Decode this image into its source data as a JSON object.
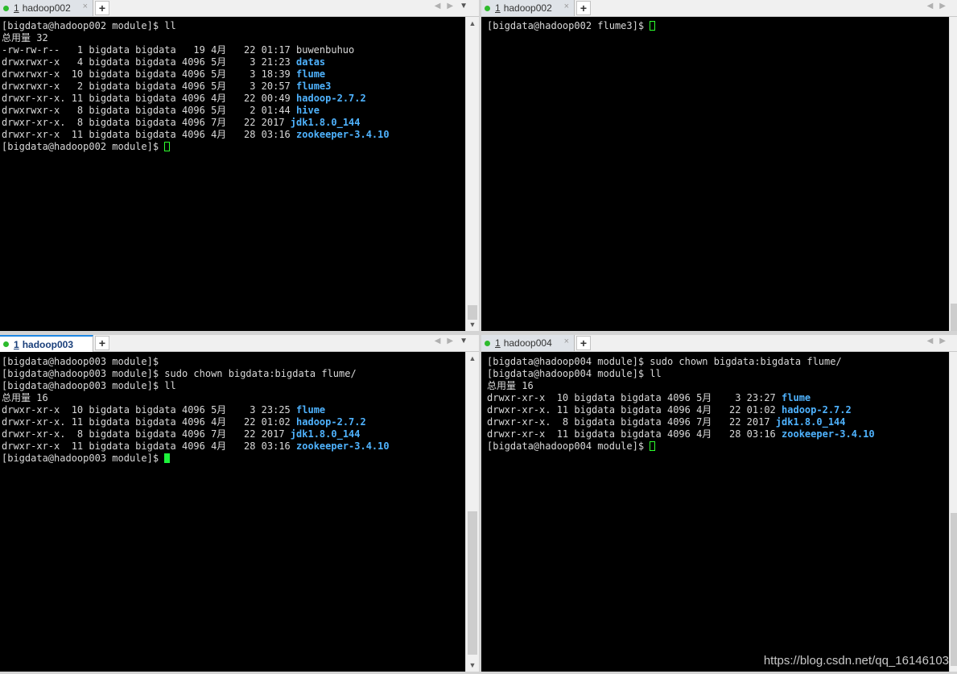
{
  "icons": {
    "close": "×",
    "plus": "+",
    "nav_left": "◀",
    "nav_right": "▶",
    "menu": "▼",
    "scroll_up": "▲",
    "scroll_down": "▼"
  },
  "panes": {
    "p1": {
      "tab": {
        "num": "1",
        "name": "hadoop002"
      },
      "lines": [
        [
          {
            "t": "[bigdata@hadoop002 module]$ ll"
          }
        ],
        [
          {
            "t": "总用量 32"
          }
        ],
        [
          {
            "t": "-rw-rw-r--   1 bigdata bigdata   19 4月   22 01:17 buwenbuhuo"
          }
        ],
        [
          {
            "t": "drwxrwxr-x   4 bigdata bigdata 4096 5月    3 21:23 "
          },
          {
            "t": "datas",
            "c": "dir"
          }
        ],
        [
          {
            "t": "drwxrwxr-x  10 bigdata bigdata 4096 5月    3 18:39 "
          },
          {
            "t": "flume",
            "c": "dir"
          }
        ],
        [
          {
            "t": "drwxrwxr-x   2 bigdata bigdata 4096 5月    3 20:57 "
          },
          {
            "t": "flume3",
            "c": "dir"
          }
        ],
        [
          {
            "t": "drwxr-xr-x. 11 bigdata bigdata 4096 4月   22 00:49 "
          },
          {
            "t": "hadoop-2.7.2",
            "c": "dir"
          }
        ],
        [
          {
            "t": "drwxrwxr-x   8 bigdata bigdata 4096 5月    2 01:44 "
          },
          {
            "t": "hive",
            "c": "dir"
          }
        ],
        [
          {
            "t": "drwxr-xr-x.  8 bigdata bigdata 4096 7月   22 2017 "
          },
          {
            "t": "jdk1.8.0_144",
            "c": "dir"
          }
        ],
        [
          {
            "t": "drwxr-xr-x  11 bigdata bigdata 4096 4月   28 03:16 "
          },
          {
            "t": "zookeeper-3.4.10",
            "c": "dir"
          }
        ],
        [
          {
            "t": "[bigdata@hadoop002 module]$ "
          },
          {
            "c": "cur"
          }
        ]
      ]
    },
    "p2": {
      "tab": {
        "num": "1",
        "name": "hadoop002"
      },
      "lines": [
        [
          {
            "t": "[bigdata@hadoop002 flume3]$ "
          },
          {
            "c": "cur"
          }
        ]
      ]
    },
    "p3": {
      "tab": {
        "num": "1",
        "name": "hadoop003"
      },
      "lines": [
        [
          {
            "t": "[bigdata@hadoop003 module]$"
          }
        ],
        [
          {
            "t": "[bigdata@hadoop003 module]$ sudo chown bigdata:bigdata flume/"
          }
        ],
        [
          {
            "t": "[bigdata@hadoop003 module]$ ll"
          }
        ],
        [
          {
            "t": "总用量 16"
          }
        ],
        [
          {
            "t": "drwxr-xr-x  10 bigdata bigdata 4096 5月    3 23:25 "
          },
          {
            "t": "flume",
            "c": "dir"
          }
        ],
        [
          {
            "t": "drwxr-xr-x. 11 bigdata bigdata 4096 4月   22 01:02 "
          },
          {
            "t": "hadoop-2.7.2",
            "c": "dir"
          }
        ],
        [
          {
            "t": "drwxr-xr-x.  8 bigdata bigdata 4096 7月   22 2017 "
          },
          {
            "t": "jdk1.8.0_144",
            "c": "dir"
          }
        ],
        [
          {
            "t": "drwxr-xr-x  11 bigdata bigdata 4096 4月   28 03:16 "
          },
          {
            "t": "zookeeper-3.4.10",
            "c": "dir"
          }
        ],
        [
          {
            "t": "[bigdata@hadoop003 module]$ "
          },
          {
            "c": "cur solid"
          }
        ]
      ]
    },
    "p4": {
      "tab": {
        "num": "1",
        "name": "hadoop004"
      },
      "lines": [
        [
          {
            "t": "[bigdata@hadoop004 module]$ sudo chown bigdata:bigdata flume/"
          }
        ],
        [
          {
            "t": "[bigdata@hadoop004 module]$ ll"
          }
        ],
        [
          {
            "t": "总用量 16"
          }
        ],
        [
          {
            "t": "drwxr-xr-x  10 bigdata bigdata 4096 5月    3 23:27 "
          },
          {
            "t": "flume",
            "c": "dir"
          }
        ],
        [
          {
            "t": "drwxr-xr-x. 11 bigdata bigdata 4096 4月   22 01:02 "
          },
          {
            "t": "hadoop-2.7.2",
            "c": "dir"
          }
        ],
        [
          {
            "t": "drwxr-xr-x.  8 bigdata bigdata 4096 7月   22 2017 "
          },
          {
            "t": "jdk1.8.0_144",
            "c": "dir"
          }
        ],
        [
          {
            "t": "drwxr-xr-x  11 bigdata bigdata 4096 4月   28 03:16 "
          },
          {
            "t": "zookeeper-3.4.10",
            "c": "dir"
          }
        ],
        [
          {
            "t": "[bigdata@hadoop004 module]$ "
          },
          {
            "c": "cur"
          }
        ]
      ]
    }
  },
  "watermark": "https://blog.csdn.net/qq_16146103"
}
